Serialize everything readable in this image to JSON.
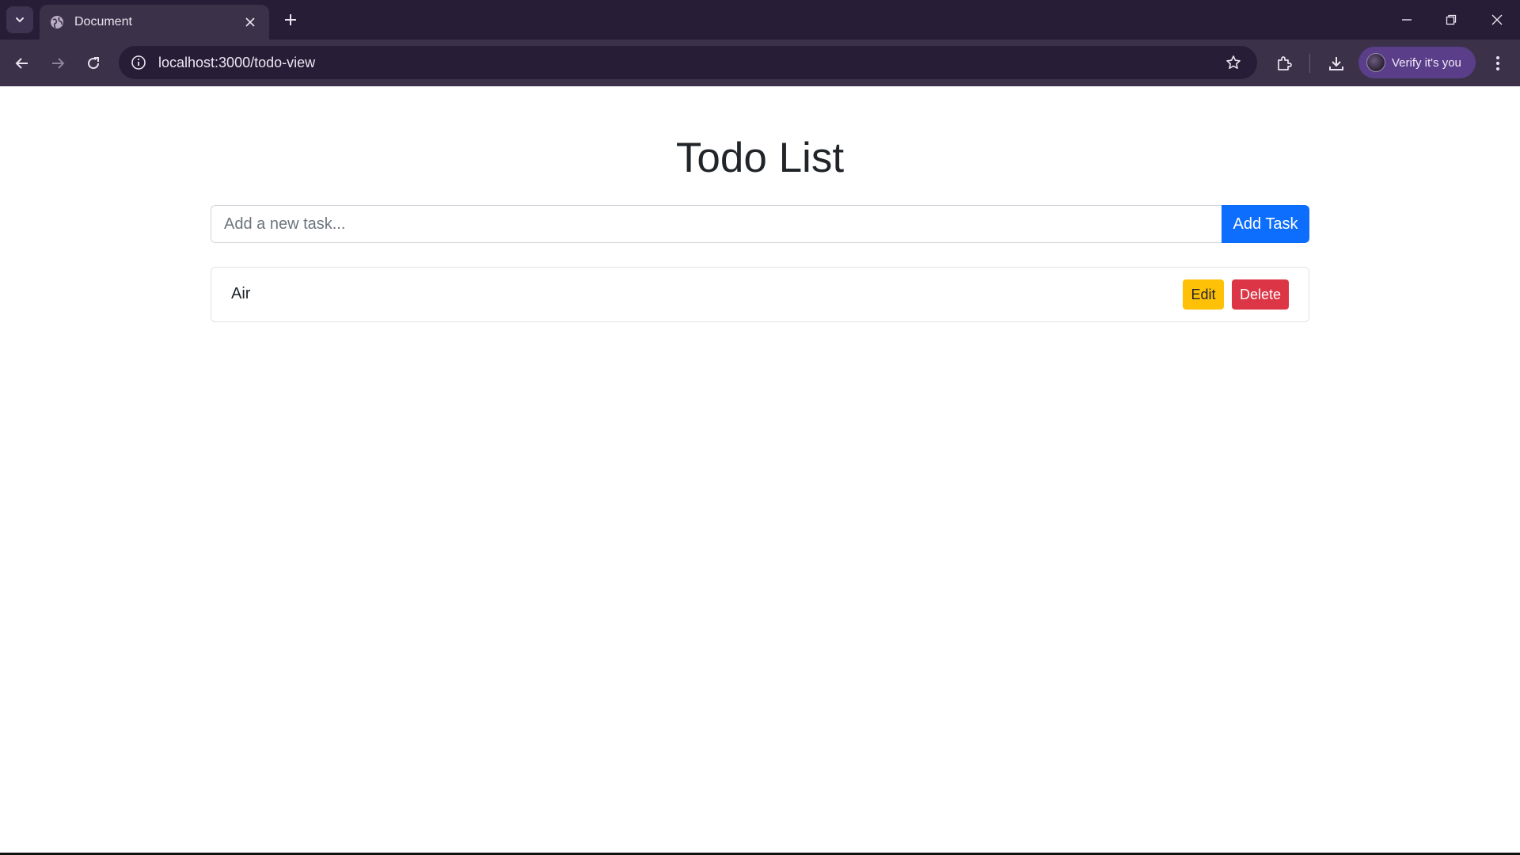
{
  "browser": {
    "tab": {
      "title": "Document",
      "favicon": "globe-icon"
    },
    "address_bar": {
      "url": "localhost:3000/todo-view"
    },
    "profile": {
      "label": "Verify it's you"
    },
    "colors": {
      "tabstrip": "#271d36",
      "toolbar": "#3b3149",
      "profile_chip": "#5a3e8a"
    }
  },
  "page": {
    "title": "Todo List",
    "input": {
      "placeholder": "Add a new task...",
      "value": ""
    },
    "add_button": "Add Task",
    "todos": [
      {
        "text": "Air",
        "edit_label": "Edit",
        "delete_label": "Delete"
      }
    ],
    "colors": {
      "primary": "#0d6efd",
      "warning": "#ffc107",
      "danger": "#dc3545"
    }
  }
}
